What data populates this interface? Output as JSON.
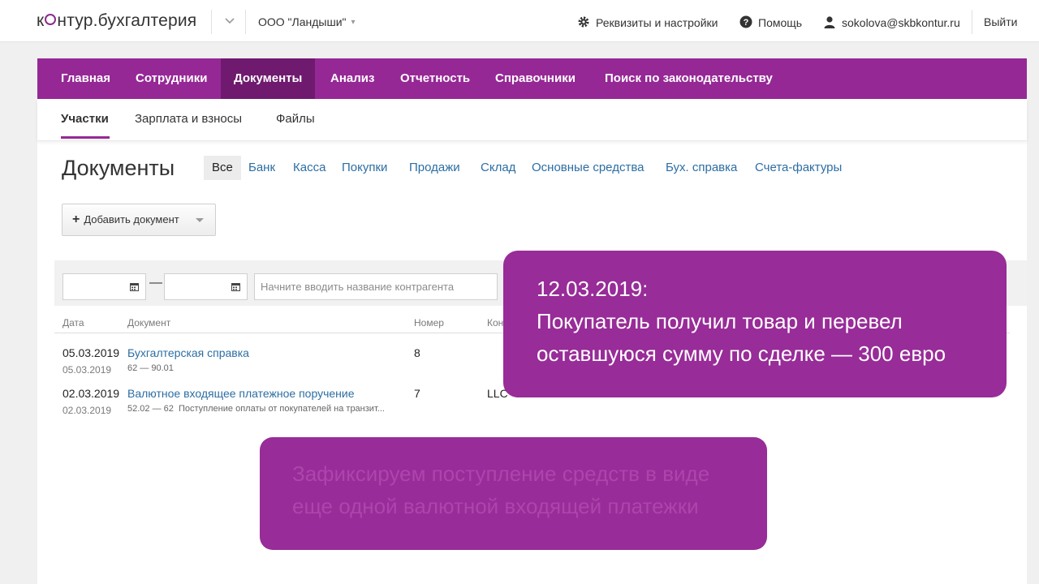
{
  "header": {
    "logo_left": "к",
    "logo_right": "нтур.",
    "logo_product": "бухгалтерия",
    "organization": "ООО \"Ландыши\"",
    "settings_label": "Реквизиты и настройки",
    "help_label": "Помощь",
    "user_email": "sokolova@skbkontur.ru",
    "logout_label": "Выйти"
  },
  "main_nav": {
    "items": [
      {
        "label": "Главная"
      },
      {
        "label": "Сотрудники"
      },
      {
        "label": "Документы",
        "active": true
      },
      {
        "label": "Анализ"
      },
      {
        "label": "Отчетность"
      },
      {
        "label": "Справочники"
      },
      {
        "label": "Поиск по законодательству"
      }
    ]
  },
  "sub_nav": {
    "items": [
      {
        "label": "Участки",
        "active": true
      },
      {
        "label": "Зарплата и взносы"
      },
      {
        "label": "Файлы"
      }
    ]
  },
  "page": {
    "title": "Документы",
    "filters": [
      {
        "label": "Все",
        "active": true
      },
      {
        "label": "Банк"
      },
      {
        "label": "Касса"
      },
      {
        "label": "Покупки"
      },
      {
        "label": "Продажи"
      },
      {
        "label": "Склад"
      },
      {
        "label": "Основные средства"
      },
      {
        "label": "Бух. справка"
      },
      {
        "label": "Счета-фактуры"
      }
    ],
    "add_button": "Добавить документ",
    "date_separator": "—",
    "search_placeholder": "Начните вводить название контрагента"
  },
  "table": {
    "columns": [
      "Дата",
      "Документ",
      "Номер",
      "Кон"
    ],
    "rows": [
      {
        "date": "05.03.2019",
        "sub_date": "05.03.2019",
        "document": "Бухгалтерская справка",
        "accounts": "62 — 90.01",
        "description": "",
        "number": "8",
        "counterparty": ""
      },
      {
        "date": "02.03.2019",
        "sub_date": "02.03.2019",
        "document": "Валютное входящее платежное поручение",
        "accounts": "52.02 — 62",
        "description": "Поступление оплаты от покупателей на транзит...",
        "number": "7",
        "counterparty": "LLC"
      }
    ]
  },
  "overlays": {
    "top": {
      "date": "12.03.2019:",
      "line1": "Покупатель получил товар и перевел",
      "line2": "оставшуюся сумму по сделке — 300 евро"
    },
    "bottom": {
      "line1": "Зафиксируем поступление средств в виде",
      "line2": "еще одной валютной входящей платежки"
    }
  },
  "colors": {
    "brand": "#962896",
    "brand_active": "#6f1a6f",
    "overlay": "#982c98",
    "link": "#2c6ea3"
  },
  "icons": {
    "org_switch": "chevron-down-icon",
    "settings": "gear-icon",
    "help": "question-circle-icon",
    "user": "user-icon",
    "calendar": "calendar-icon",
    "add": "plus-icon"
  }
}
